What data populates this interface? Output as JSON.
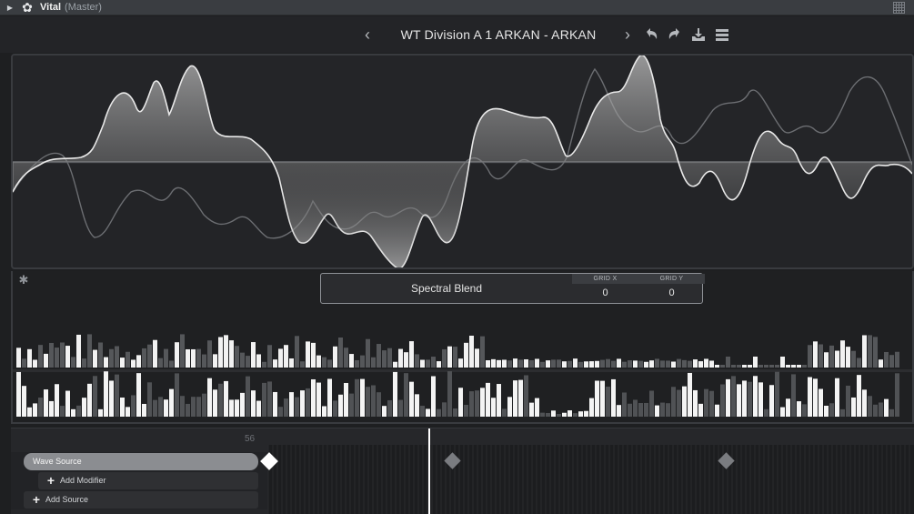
{
  "host": {
    "plugin_name": "Vital",
    "plugin_context": "(Master)",
    "icons": {
      "collapse": "triangle-right-icon",
      "plugin": "gear-icon",
      "grid": "grid-icon"
    }
  },
  "preset": {
    "name": "WT Division A 1 ARKAN  -  ARKAN",
    "prev_glyph": "‹",
    "next_glyph": "›",
    "icons": [
      "undo-icon",
      "redo-icon",
      "save-icon",
      "menu-icon"
    ]
  },
  "spectral": {
    "blend_label": "Spectral Blend",
    "grid_x_label": "GRID X",
    "grid_x_value": "0",
    "grid_y_label": "GRID Y",
    "grid_y_value": "0"
  },
  "modulation": {
    "frame_number": "56",
    "rows": {
      "wave_source": "Wave Source",
      "add_modifier": "Add Modifier",
      "add_source": "Add Source"
    }
  },
  "colors": {
    "background": "#1e1f21",
    "panel": "#232427",
    "wave_fill": "#f2f2f2",
    "bar_bright": "#f4f4f4",
    "bar_dim": "#5a5b5e",
    "playhead": "#ffffff"
  }
}
